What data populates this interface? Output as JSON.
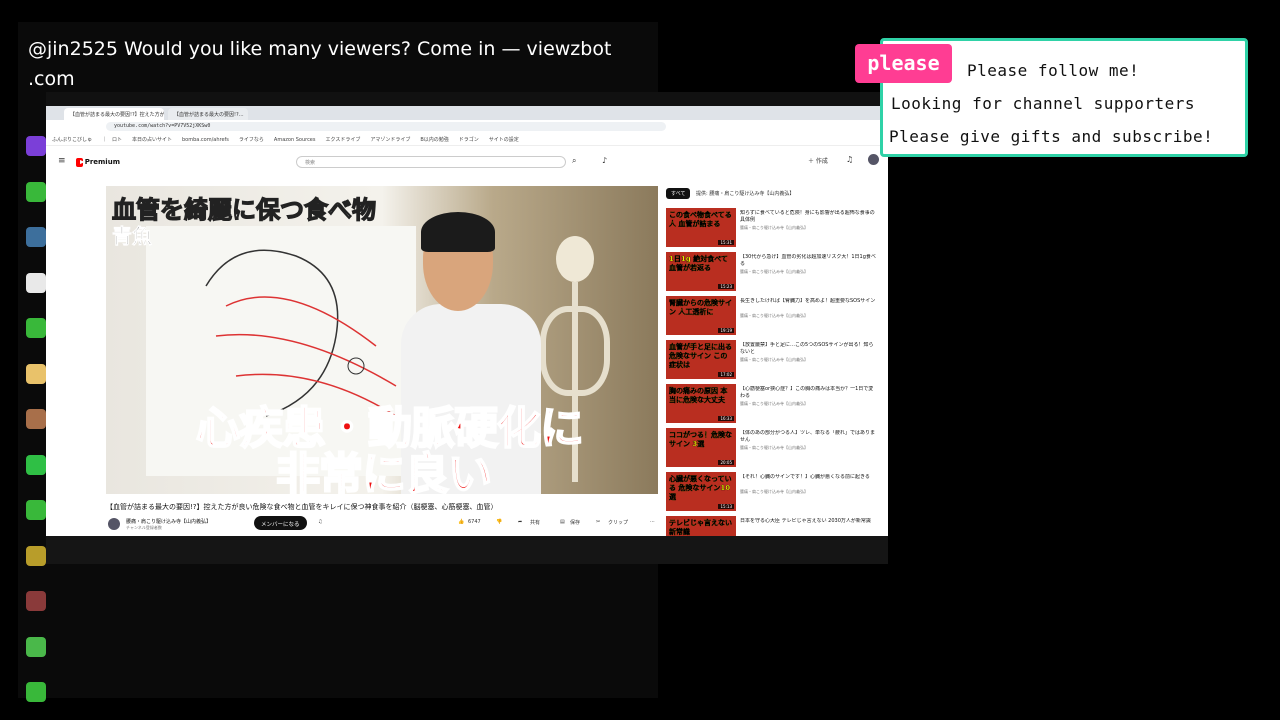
{
  "chat": {
    "message": "@jin2525 Would you like many viewers? Come in — viewzbot .com"
  },
  "avatar_colors": [
    "#7b3fd8",
    "#39b83a",
    "#3d6f9c",
    "#e9e9e9",
    "#39b83a",
    "#e9c26a",
    "#a86f4a",
    "#2fbf45",
    "#39b83a",
    "#b89d2a",
    "#8a3a3a",
    "#4ab84a",
    "#39b83a"
  ],
  "browser": {
    "tabs": [
      "【血管が詰まる最大の要因!?】控えた方が良い危険な食べ物と血管を…",
      "【血管が詰まる最大の要因!?…"
    ],
    "url": "youtube.com/watch?v=PV7V52jXKSw0",
    "bookmarks": "ふんぷりこびしゅ　　｜　ロト　　本日の占いサイト　　bomba.com/ahrefs　　ライフなら　　Amazon Sources　　エクスドライブ　　アマゾンドライブ　　B以内の勉強　　ドラゴン　　サイトの設定"
  },
  "youtube": {
    "logo_text": "Premium",
    "search_placeholder": "検索",
    "create_label": "＋ 作成",
    "video": {
      "caption_top": "血管を綺麗に保つ食べ物",
      "caption_fish": "青魚",
      "big_line1": "心疾患・動脈硬化に",
      "big_line2": "非常に良い",
      "title": "【血管が詰まる最大の要因!?】控えた方が良い危険な食べ物と血管をキレイに保つ神食事を紹介（脳梗塞、心筋梗塞、血管）",
      "channel": "腰痛・肩こり駆け込み寺【山内義弘】",
      "subs": "チャンネル登録者数",
      "member_button": "メンバーになる",
      "likes": "6747",
      "share": "共有",
      "save": "保存",
      "clip": "クリップ"
    },
    "chips": [
      "すべて",
      "提供: 腰痛・肩こり駆け込み寺【山内義弘】"
    ],
    "recommendations": [
      {
        "thumb": "この食べ物食べてる人 血管が詰まる",
        "dur": "15:31",
        "title": "知らずに食べていると危険！身にも影響が出る超怖な食事の具体例",
        "meta": "腰痛・肩こり駆け込み寺【山内義弘】"
      },
      {
        "thumb": "1日1g 絶対食べて 血管が若返る",
        "dur": "15:23",
        "title": "【30代から急げ】血管の劣化は超加速リスク大！1日1g食べる",
        "meta": "腰痛・肩こり駆け込み寺【山内義弘】"
      },
      {
        "thumb": "腎臓からの危険サイン 人工透析に",
        "dur": "19:19",
        "title": "長生きしたければ【腎臓力】を高めよ！超重要なSOSサイン",
        "meta": "腰痛・肩こり駆け込み寺【山内義弘】"
      },
      {
        "thumb": "血管が手と足に出る 危険なサイン この症状は",
        "dur": "17:02",
        "title": "【放置厳禁】手と足に…この5つのSOSサインが出る！知らないと",
        "meta": "腰痛・肩こり駆け込み寺【山内義弘】"
      },
      {
        "thumb": "胸の痛みの原因 本当に危険な大丈夫",
        "dur": "16:33",
        "title": "【心筋梗塞or狭心症？】この胸の痛みは本当か？一1日で変わる",
        "meta": "腰痛・肩こり駆け込み寺【山内義弘】"
      },
      {
        "thumb": "ココがつる！危険なサイン 3選",
        "dur": "20:05",
        "title": "【体のあの部分がつる人】ツレ、単なる「疲れ」ではありません",
        "meta": "腰痛・肩こり駆け込み寺【山内義弘】"
      },
      {
        "thumb": "心臓が悪くなっている 危険なサイン10選",
        "dur": "15:13",
        "title": "【それ！心臓のサインです！】心臓が悪くなる前に起きる",
        "meta": "腰痛・肩こり駆け込み寺【山内義弘】"
      },
      {
        "thumb": "テレビじゃ言えない 新常識",
        "dur": "",
        "title": "日本を守る心大臣 テレビじゃ言えない 2030万人が新常識",
        "meta": ""
      }
    ]
  },
  "overlay": {
    "badge": "please",
    "line1": "Please follow me!",
    "line2": "Looking for channel supporters",
    "line3": "Please give gifts and subscribe!",
    "accent_color": "#2fd2a7",
    "badge_color": "#ff3d93"
  }
}
